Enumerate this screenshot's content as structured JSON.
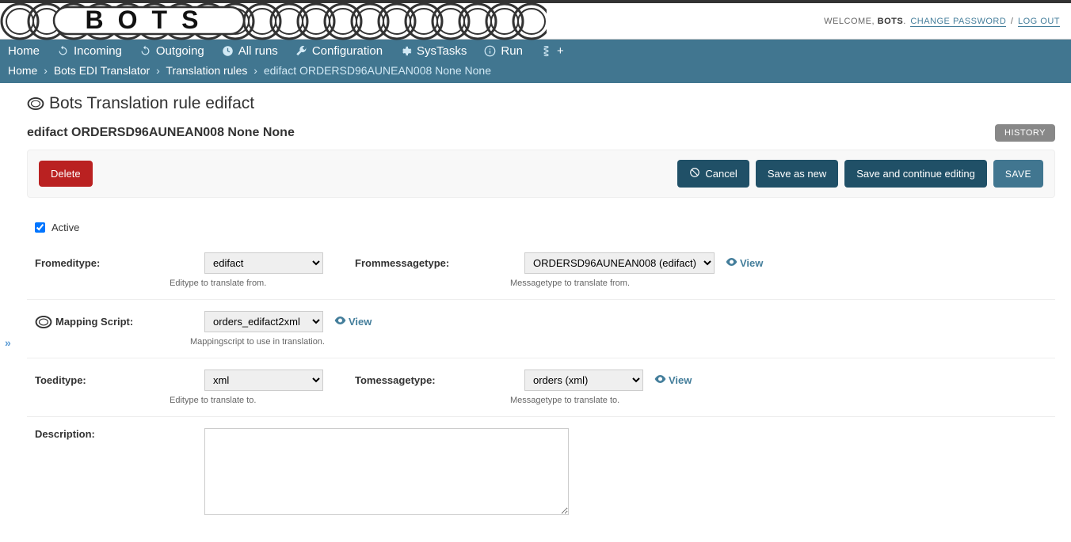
{
  "user_tools": {
    "welcome": "WELCOME,",
    "username": "BOTS",
    "change_password": "CHANGE PASSWORD",
    "logout": "LOG OUT"
  },
  "nav": {
    "home": "Home",
    "incoming": "Incoming",
    "outgoing": "Outgoing",
    "allruns": "All runs",
    "configuration": "Configuration",
    "systasks": "SysTasks",
    "run": "Run",
    "plus": "+"
  },
  "breadcrumbs": {
    "home": "Home",
    "app": "Bots EDI Translator",
    "model": "Translation rules",
    "current": "edifact ORDERSD96AUNEAN008 None None"
  },
  "page": {
    "title": "Bots Translation rule edifact",
    "obj_title": "edifact ORDERSD96AUNEAN008 None None",
    "history": "HISTORY"
  },
  "actions": {
    "delete": "Delete",
    "cancel": "Cancel",
    "save_as_new": "Save as new",
    "save_continue": "Save and continue editing",
    "save": "SAVE"
  },
  "form": {
    "active_label": "Active",
    "fromeditype_label": "Fromeditype:",
    "fromeditype_value": "edifact",
    "fromeditype_help": "Editype to translate from.",
    "frommessagetype_label": "Frommessagetype:",
    "frommessagetype_value": "ORDERSD96AUNEAN008 (edifact)",
    "frommessagetype_help": "Messagetype to translate from.",
    "mapping_label": "Mapping Script:",
    "mapping_value": "orders_edifact2xml",
    "mapping_help": "Mappingscript to use in translation.",
    "toeditype_label": "Toeditype:",
    "toeditype_value": "xml",
    "toeditype_help": "Editype to translate to.",
    "tomessagetype_label": "Tomessagetype:",
    "tomessagetype_value": "orders (xml)",
    "tomessagetype_help": "Messagetype to translate to.",
    "description_label": "Description:",
    "view": "View"
  }
}
